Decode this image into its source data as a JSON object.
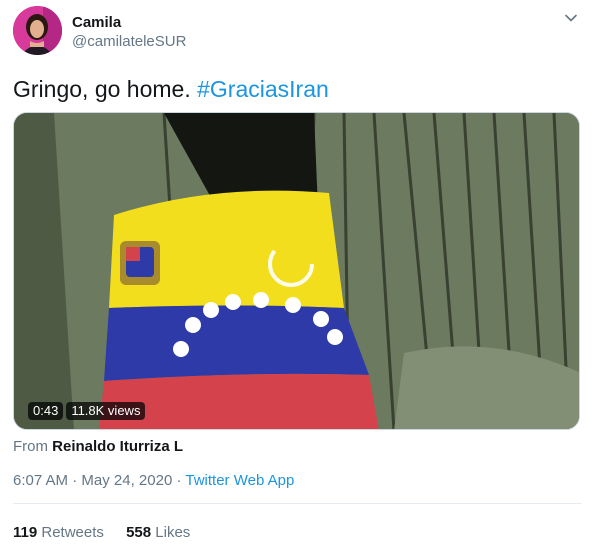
{
  "author": {
    "name": "Camila",
    "handle": "@camilateleSUR"
  },
  "tweet": {
    "text": "Gringo, go home.",
    "hashtag": "#GraciasIran"
  },
  "media": {
    "duration": "0:43",
    "views": "11.8K views"
  },
  "attribution": {
    "prefix": "From",
    "source": "Reinaldo Iturriza L"
  },
  "meta": {
    "time": "6:07 AM",
    "separator": "·",
    "date": "May 24, 2020",
    "app": "Twitter Web App"
  },
  "stats": {
    "retweets_count": "119",
    "retweets_label": "Retweets",
    "likes_count": "558",
    "likes_label": "Likes"
  },
  "colors": {
    "link": "#1b95e0",
    "secondary_text": "#657786",
    "divider": "#e6ecf0"
  },
  "icons": {
    "menu": "chevron-down-icon"
  }
}
